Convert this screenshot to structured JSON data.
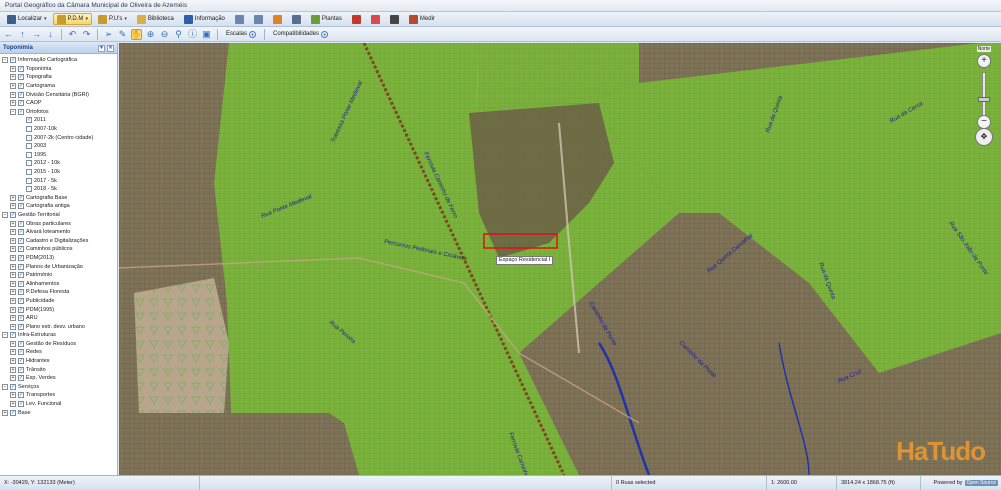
{
  "app": {
    "title": "Portal Geográfico da Câmara Municipal de Oliveira de Azeméis"
  },
  "menubar": {
    "items": [
      {
        "label": "Localizar",
        "icon": "binoculars-icon"
      },
      {
        "label": "P.D.M",
        "icon": "map-icon",
        "active": true
      },
      {
        "label": "P.U's",
        "icon": "map-icon"
      },
      {
        "label": "Biblioteca",
        "icon": "folder-icon"
      },
      {
        "label": "Informação",
        "icon": "book-icon"
      },
      {
        "label": "Plantas",
        "icon": "layers-icon"
      },
      {
        "label": "Medir",
        "icon": "ruler-icon"
      }
    ]
  },
  "toolbar": {
    "scales_label": "Escalas",
    "compat_label": "Compatibilidades"
  },
  "sidebar": {
    "title": "Toponímia",
    "tree": [
      {
        "label": "Informação Cartográfica",
        "level": 1,
        "exp": "-",
        "checked": true
      },
      {
        "label": "Toponímia",
        "level": 2,
        "exp": "+",
        "checked": true
      },
      {
        "label": "Topografia",
        "level": 2,
        "exp": "+",
        "checked": true
      },
      {
        "label": "Cartograma",
        "level": 2,
        "exp": "+",
        "checked": true
      },
      {
        "label": "Divisão Censitária (BGRI)",
        "level": 2,
        "exp": "+",
        "checked": true
      },
      {
        "label": "CAOP",
        "level": 2,
        "exp": "+",
        "checked": true
      },
      {
        "label": "Ortofotos",
        "level": 2,
        "exp": "-",
        "checked": true
      },
      {
        "label": "2011",
        "level": 3,
        "exp": "",
        "checked": true
      },
      {
        "label": "2007-10k",
        "level": 3,
        "exp": "",
        "checked": false
      },
      {
        "label": "2007-2k (Centro cidade)",
        "level": 3,
        "exp": "",
        "checked": false
      },
      {
        "label": "2003",
        "level": 3,
        "exp": "",
        "checked": false
      },
      {
        "label": "1995",
        "level": 3,
        "exp": "",
        "checked": false
      },
      {
        "label": "2012 - 10k",
        "level": 3,
        "exp": "",
        "checked": false
      },
      {
        "label": "2015 - 10k",
        "level": 3,
        "exp": "",
        "checked": false
      },
      {
        "label": "2017 - 5k",
        "level": 3,
        "exp": "",
        "checked": false
      },
      {
        "label": "2018 - 5k",
        "level": 3,
        "exp": "",
        "checked": false
      },
      {
        "label": "Cartografia Base",
        "level": 2,
        "exp": "+",
        "checked": true
      },
      {
        "label": "Cartografia antiga",
        "level": 2,
        "exp": "+",
        "checked": true
      },
      {
        "label": "Gestão Territorial",
        "level": 1,
        "exp": "-",
        "checked": true
      },
      {
        "label": "Obras particulares",
        "level": 2,
        "exp": "+",
        "checked": true
      },
      {
        "label": "Alvará loteamento",
        "level": 2,
        "exp": "+",
        "checked": true
      },
      {
        "label": "Cadastro e Digitalizações",
        "level": 2,
        "exp": "+",
        "checked": true
      },
      {
        "label": "Caminhos públicos",
        "level": 2,
        "exp": "+",
        "checked": true
      },
      {
        "label": "PDM(2013)",
        "level": 2,
        "exp": "+",
        "checked": true
      },
      {
        "label": "Planos de Urbanização",
        "level": 2,
        "exp": "+",
        "checked": true
      },
      {
        "label": "Património",
        "level": 2,
        "exp": "+",
        "checked": true
      },
      {
        "label": "Alinhamentos",
        "level": 2,
        "exp": "+",
        "checked": true
      },
      {
        "label": "P.Defesa Floresta",
        "level": 2,
        "exp": "+",
        "checked": true
      },
      {
        "label": "Publicidade",
        "level": 2,
        "exp": "+",
        "checked": true
      },
      {
        "label": "PDM(1995)",
        "level": 2,
        "exp": "+",
        "checked": true
      },
      {
        "label": "ARU",
        "level": 2,
        "exp": "+",
        "checked": true
      },
      {
        "label": "Plano estr. desv. urbano",
        "level": 2,
        "exp": "+",
        "checked": true
      },
      {
        "label": "Infra-Estruturas",
        "level": 1,
        "exp": "-",
        "checked": true
      },
      {
        "label": "Gestão de Resíduos",
        "level": 2,
        "exp": "+",
        "checked": true
      },
      {
        "label": "Redes",
        "level": 2,
        "exp": "+",
        "checked": true
      },
      {
        "label": "Hidrantes",
        "level": 2,
        "exp": "+",
        "checked": true
      },
      {
        "label": "Trânsito",
        "level": 2,
        "exp": "+",
        "checked": true
      },
      {
        "label": "Esp. Verdes",
        "level": 2,
        "exp": "+",
        "checked": true
      },
      {
        "label": "Serviços",
        "level": 1,
        "exp": "-",
        "checked": true
      },
      {
        "label": "Transportes",
        "level": 2,
        "exp": "+",
        "checked": true
      },
      {
        "label": "Lev. Funcional",
        "level": 2,
        "exp": "+",
        "checked": true
      },
      {
        "label": "Base",
        "level": 1,
        "exp": "+",
        "checked": true
      }
    ]
  },
  "map": {
    "north_label": "Norte",
    "selection_label": "Espaço Residencial I",
    "watermark": "HaTudo",
    "street_labels": [
      "Percursos Pedonais e Cicláveis",
      "Rua Ponte Medieval",
      "Travessa Ponte Medieval",
      "Ferrovia Caminho de Ferro",
      "Ferrovia Caminho de Ferro",
      "Rua da Quinta",
      "Rua da Quinta",
      "Rua da Cerca",
      "Rua São João da Ponte",
      "Caminho da Ponte",
      "Caminho da Ponte",
      "Rua Quinta Carvalhal",
      "Rua Cruz",
      "Rua Pereira"
    ]
  },
  "statusbar": {
    "coords": "X: -30429, Y: 132133 (Meter)",
    "selection": "0 Ruas selected",
    "scale": "1: 2600.00",
    "extent": "3814.24 x 1868.75 (ft)",
    "powered": "Powered by",
    "powered_brand": "Open Source"
  }
}
